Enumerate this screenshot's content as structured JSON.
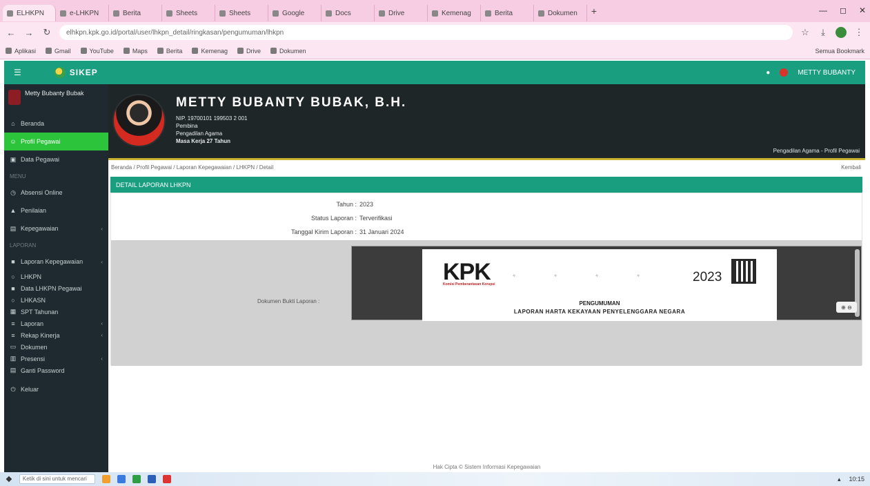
{
  "browser": {
    "tabs": [
      {
        "label": "ELHKPN",
        "active": true
      },
      {
        "label": "e-LHKPN",
        "active": false
      },
      {
        "label": "Berita",
        "active": false
      },
      {
        "label": "Sheets",
        "active": false
      },
      {
        "label": "Sheets",
        "active": false
      },
      {
        "label": "Google",
        "active": false
      },
      {
        "label": "Docs",
        "active": false
      },
      {
        "label": "Drive",
        "active": false
      },
      {
        "label": "Kemenag",
        "active": false
      },
      {
        "label": "Berita",
        "active": false
      },
      {
        "label": "Dokumen",
        "active": false
      }
    ],
    "new_tab": "+",
    "url": "elhkpn.kpk.go.id/portal/user/lhkpn_detail/ringkasan/pengumuman/lhkpn",
    "bookmarks": [
      "Aplikasi",
      "Gmail",
      "YouTube",
      "Maps",
      "Berita",
      "Kemenag",
      "Drive",
      "Dokumen"
    ],
    "all_bookmarks": "Semua Bookmark"
  },
  "app": {
    "logo_text": "SIKEP",
    "topnav_user": "METTY BUBANTY"
  },
  "sidebar": {
    "user_name": "Metty Bubanty Bubak",
    "items": [
      {
        "label": "Beranda",
        "icon": "home-icon",
        "glyph": "⌂"
      },
      {
        "label": "Profil Pegawai",
        "icon": "user-icon",
        "glyph": "☺",
        "active": true
      },
      {
        "label": "Data Pegawai",
        "icon": "users-icon",
        "glyph": "▣"
      }
    ],
    "header_1": "MENU",
    "items2": [
      {
        "label": "Absensi Online",
        "icon": "clock-icon",
        "glyph": "◷"
      },
      {
        "label": "Penilaian",
        "icon": "chart-icon",
        "glyph": "▲"
      },
      {
        "label": "Kepegawaian",
        "icon": "folder-icon",
        "glyph": "▤",
        "caret": "‹"
      }
    ],
    "header_2": "LAPORAN",
    "items3": [
      {
        "label": "Laporan Kepegawaian",
        "icon": "file-icon",
        "glyph": "■",
        "caret": "‹"
      }
    ],
    "sub_items": [
      {
        "label": "LHKPN",
        "glyph": "○"
      },
      {
        "label": "Data LHKPN Pegawai",
        "glyph": "■"
      },
      {
        "label": "LHKASN",
        "glyph": "○"
      },
      {
        "label": "SPT Tahunan",
        "glyph": "▦"
      },
      {
        "label": "Laporan",
        "glyph": "≡",
        "caret": "‹"
      },
      {
        "label": "Rekap Kinerja",
        "glyph": "≡",
        "caret": "‹"
      },
      {
        "label": "Dokumen",
        "glyph": "▭"
      },
      {
        "label": "Presensi",
        "glyph": "▥",
        "caret": "‹"
      },
      {
        "label": "Ganti Password",
        "glyph": "▤"
      }
    ],
    "logout": "Keluar"
  },
  "profile": {
    "name": "METTY BUBANTY BUBAK, B.H.",
    "lines": [
      "NIP. 19700101 199503 2 001",
      "Pembina",
      "Pengadilan Agama",
      "Masa Kerja 27 Tahun"
    ],
    "right_text": "Pengadilan Agama - Profil Pegawai"
  },
  "breadcrumb": "Beranda / Profil Pegawai / Laporan Kepegawaian / LHKPN / Detail",
  "breadcrumb_right": "Kembali",
  "panel": {
    "title": "DETAIL LAPORAN LHKPN",
    "rows": [
      {
        "label": "Tahun :",
        "value": "2023"
      },
      {
        "label": "Status Laporan :",
        "value": "Terverifikasi"
      },
      {
        "label": "Tanggal Kirim Laporan :",
        "value": "31 Januari 2024"
      }
    ],
    "doc_label": "Dokumen Bukti Laporan :"
  },
  "document": {
    "logo": "KPK",
    "logo_sub": "Komisi Pemberantasan Korupsi",
    "year": "2023",
    "title1": "PENGUMUMAN",
    "title2": "LAPORAN HARTA KEKAYAAN PENYELENGGARA NEGARA",
    "zoom": "⊕ ⊖"
  },
  "footer": "Hak Cipta © Sistem Informasi Kepegawaian",
  "taskbar": {
    "start": "❖",
    "search": "Ketik di sini untuk mencari",
    "clock": "10:15"
  }
}
